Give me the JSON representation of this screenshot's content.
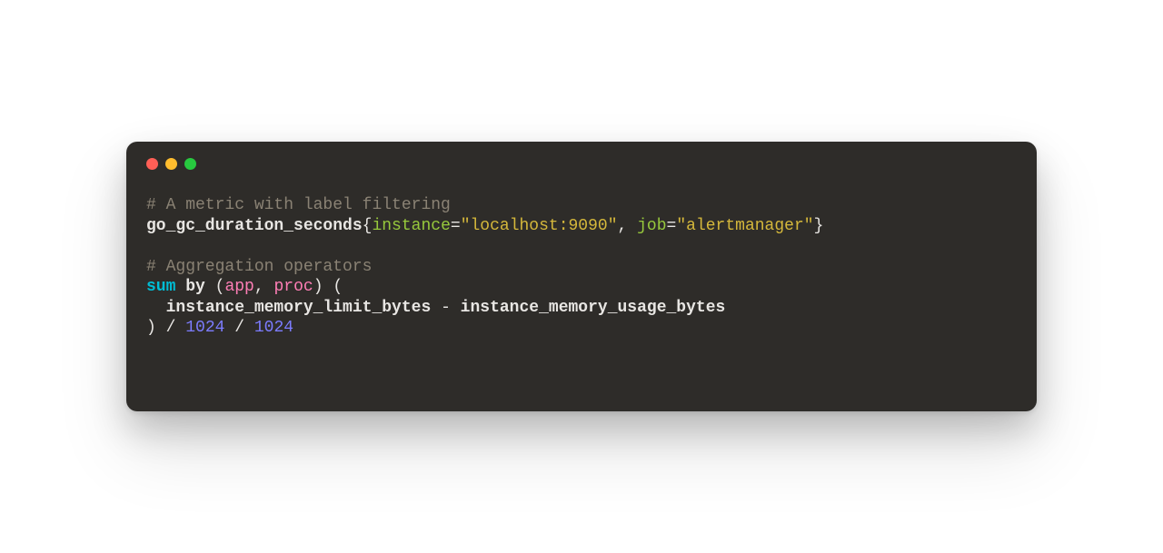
{
  "code": {
    "c1": "# A metric with label filtering",
    "metric1": "go_gc_duration_seconds",
    "lbrace1": "{",
    "label1": "instance",
    "eq1": "=",
    "str1": "\"localhost:9090\"",
    "comma1": ", ",
    "label2": "job",
    "eq2": "=",
    "str2": "\"alertmanager\"",
    "rbrace1": "}",
    "c2": "# Aggregation operators",
    "kw_sum": "sum",
    "sp1": " ",
    "kw_by": "by",
    "sp2": " ",
    "paren_open1": "(",
    "ident_app": "app",
    "comma2": ", ",
    "ident_proc": "proc",
    "paren_close1": ")",
    "sp3": " ",
    "paren_open2": "(",
    "indent1": "  ",
    "metric2": "instance_memory_limit_bytes",
    "op_minus": " - ",
    "metric3": "instance_memory_usage_bytes",
    "paren_close2": ")",
    "op_div1": " / ",
    "num1": "1024",
    "op_div2": " / ",
    "num2": "1024"
  }
}
